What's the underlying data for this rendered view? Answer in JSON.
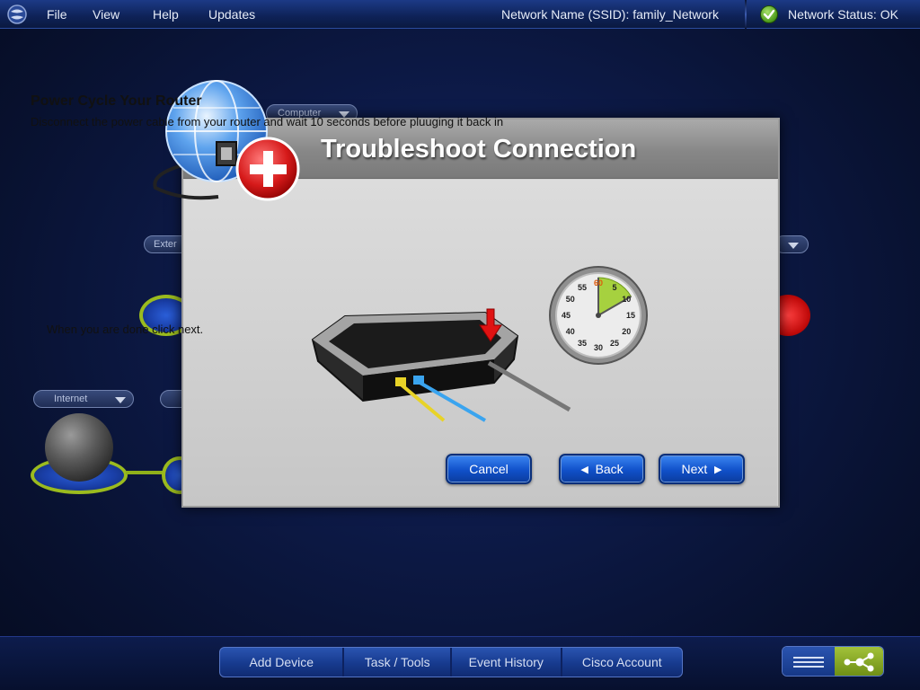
{
  "menubar": {
    "items": [
      "File",
      "View",
      "Help",
      "Updates"
    ],
    "ssid": "Network Name (SSID): family_Network",
    "status": "Network Status: OK"
  },
  "background_map": {
    "computer_dropdown": "Computer",
    "external_dropdown": "Exter",
    "internet_dropdown": "Internet"
  },
  "dialog": {
    "title": "Troubleshoot Connection",
    "heading": "Power Cycle Your Router",
    "description": "Disconnect the power cable from your router and wait 10 seconds before pluuging it back in",
    "done_text": "When you are done click next.",
    "cancel_label": "Cancel",
    "back_label": "Back",
    "next_label": "Next",
    "timer": {
      "labels": [
        "60",
        "5",
        "10",
        "15",
        "20",
        "25",
        "30",
        "35",
        "40",
        "45",
        "50",
        "55"
      ],
      "highlighted_seconds": 10
    }
  },
  "bottombar": {
    "tabs": [
      "Add Device",
      "Task / Tools",
      "Event History",
      "Cisco Account"
    ]
  },
  "colors": {
    "accent_blue": "#1050c9",
    "status_green": "#4c9a1a",
    "ring_green": "#9bbb1e"
  }
}
